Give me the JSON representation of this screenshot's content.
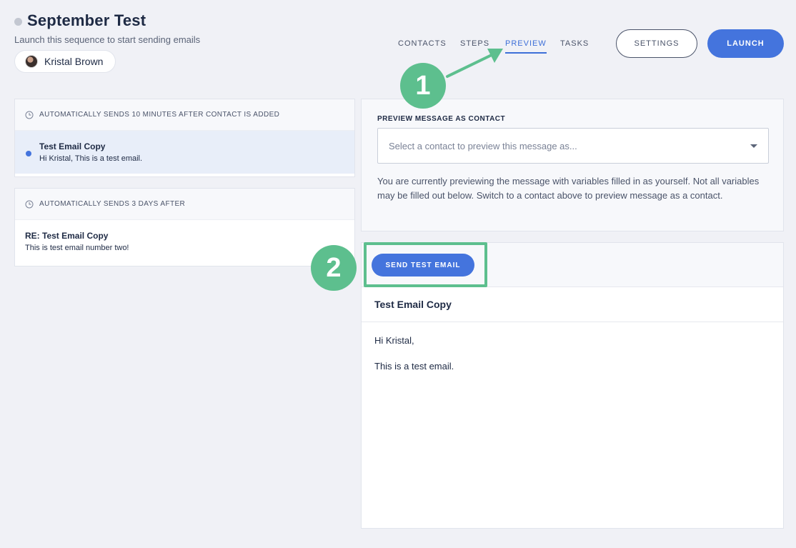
{
  "header": {
    "title": "September Test",
    "subtitle": "Launch this sequence to start sending emails",
    "owner": "Kristal Brown",
    "tabs": [
      {
        "label": "CONTACTS"
      },
      {
        "label": "STEPS"
      },
      {
        "label": "PREVIEW",
        "active": true
      },
      {
        "label": "TASKS"
      }
    ],
    "settings_label": "SETTINGS",
    "launch_label": "LAUNCH"
  },
  "steps": [
    {
      "timing": "AUTOMATICALLY SENDS 10 MINUTES AFTER CONTACT IS ADDED",
      "subject": "Test Email Copy",
      "preview": "Hi Kristal, This is a test email.",
      "selected": true
    },
    {
      "timing": "AUTOMATICALLY SENDS 3 DAYS AFTER",
      "subject": "RE: Test Email Copy",
      "preview": "This is test email number two!",
      "selected": false
    }
  ],
  "preview": {
    "label": "PREVIEW MESSAGE AS CONTACT",
    "placeholder": "Select a contact to preview this message as...",
    "note": "You are currently previewing the message with variables filled in as yourself. Not all variables may be filled out below. Switch to a contact above to preview message as a contact."
  },
  "email": {
    "send_test_label": "SEND TEST EMAIL",
    "subject": "Test Email Copy",
    "greeting": "Hi Kristal,",
    "body": "This is a test email."
  },
  "annotations": {
    "badge_1": "1",
    "badge_2": "2",
    "color": "#5dbf8e"
  },
  "colors": {
    "accent": "#4474dd",
    "background": "#f0f1f6"
  }
}
